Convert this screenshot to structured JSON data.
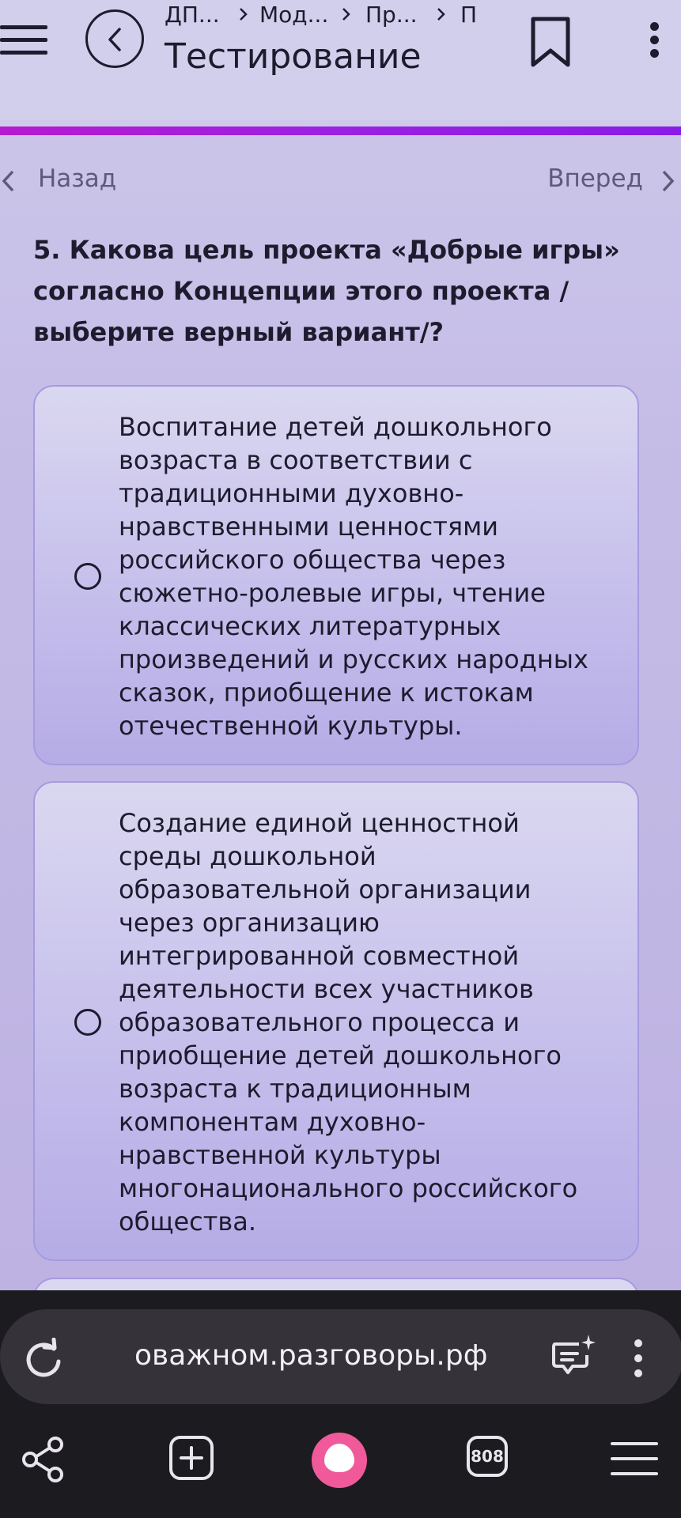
{
  "header": {
    "breadcrumbs": [
      "ДП...",
      "Мод...",
      "Пр...",
      "П"
    ],
    "title": "Тестирование"
  },
  "nav": {
    "back_label": "Назад",
    "forward_label": "Вперед"
  },
  "question": {
    "text": "5.  Какова цель проекта «Добрые игры» согласно Концепции этого проекта / выберите верный вариант/?"
  },
  "options": [
    {
      "text": "Воспитание детей дошкольного возраста в соответствии с традиционными духовно-нравственными ценностями российского общества через сюжетно-ролевые игры, чтение классических литературных произведений и русских народных сказок, приобщение к истокам отечественной культуры.",
      "selected": false
    },
    {
      "text": "Создание единой ценностной среды дошкольной образовательной организации через организацию интегрированной совместной деятельности всех участников образовательного процесса и приобщение детей дошкольного возраста к традиционным компонентам духовно-нравственной культуры многонационального российского общества.",
      "selected": false
    }
  ],
  "browser": {
    "url": "оважном.разговоры.рф",
    "tabs_count": "808"
  },
  "colors": {
    "accent_bar": "#9a22e0",
    "page_bg": "#c4bbe6",
    "alice": "#f05a9a"
  },
  "icons": [
    "menu-icon",
    "back-arrow-icon",
    "bookmark-icon",
    "more-vert-icon",
    "chevron-left-icon",
    "chevron-right-icon",
    "radio-icon",
    "reload-icon",
    "chat-sparkle-icon",
    "share-icon",
    "new-tab-icon",
    "alice-icon",
    "tabs-icon",
    "hamburger-icon"
  ]
}
